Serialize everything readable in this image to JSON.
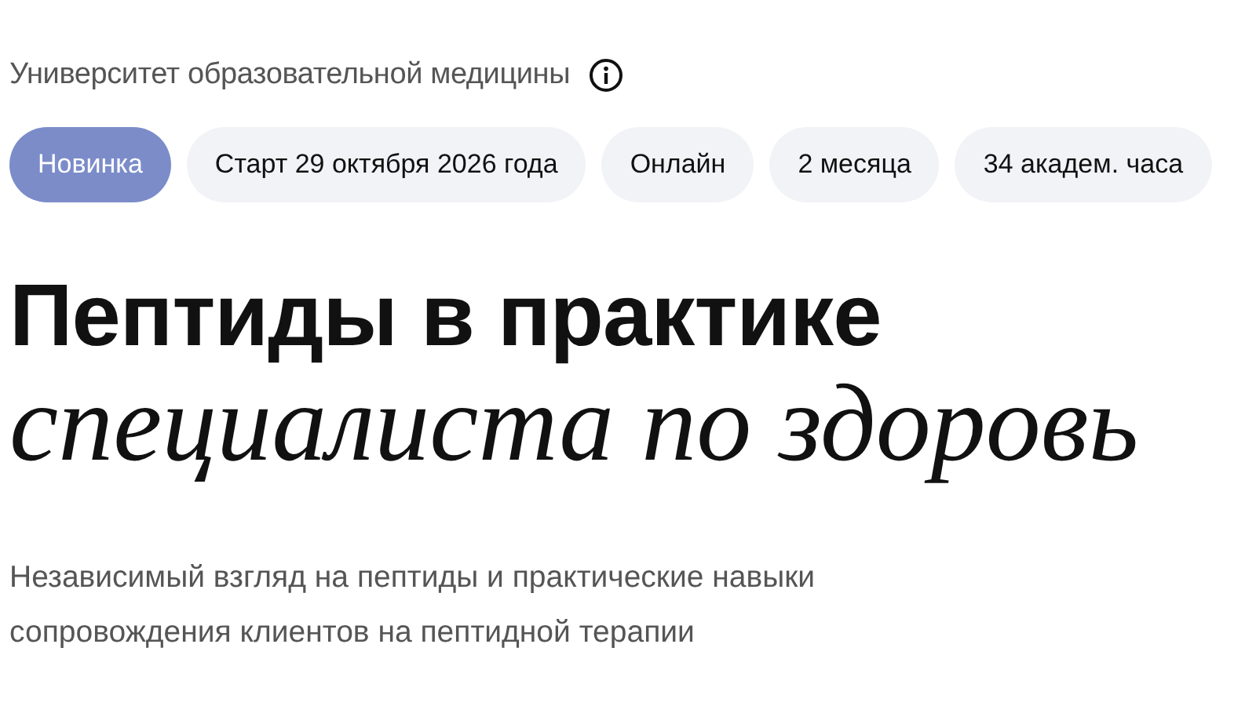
{
  "organization": {
    "name": "Университет образовательной медицины"
  },
  "tags": [
    {
      "label": "Новинка",
      "kind": "highlight"
    },
    {
      "label": "Старт 29 октября 2026 года",
      "kind": "plain"
    },
    {
      "label": "Онлайн",
      "kind": "plain"
    },
    {
      "label": "2 месяца",
      "kind": "plain"
    },
    {
      "label": "34 академ. часа",
      "kind": "plain"
    }
  ],
  "title": {
    "line_1": "Пептиды в практике",
    "line_2": "специалиста по здоровь"
  },
  "subtitle": "Независимый взгляд на пептиды и практические навыки сопровождения клиентов на пептидной терапии"
}
